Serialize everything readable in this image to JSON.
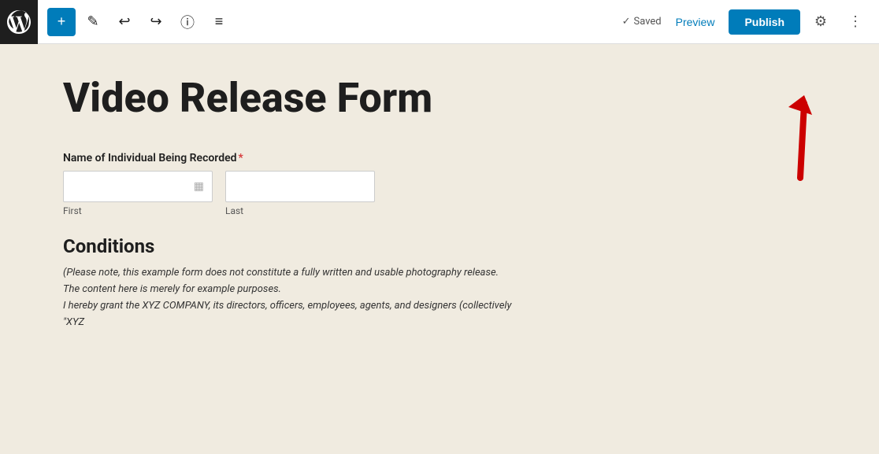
{
  "toolbar": {
    "add_label": "+",
    "saved_label": "Saved",
    "preview_label": "Preview",
    "publish_label": "Publish"
  },
  "page": {
    "title": "Video Release Form"
  },
  "form": {
    "name_field_label": "Name of Individual Being Recorded",
    "required_marker": "*",
    "first_sub_label": "First",
    "last_sub_label": "Last",
    "conditions_title": "Conditions",
    "conditions_text_line1": "(Please note, this example form does not constitute a fully written and usable photography release.",
    "conditions_text_line2": "The content here is merely for example purposes.",
    "conditions_text_line3": "I hereby grant the XYZ COMPANY, its directors, officers, employees, agents, and designers (collectively \"XYZ"
  }
}
